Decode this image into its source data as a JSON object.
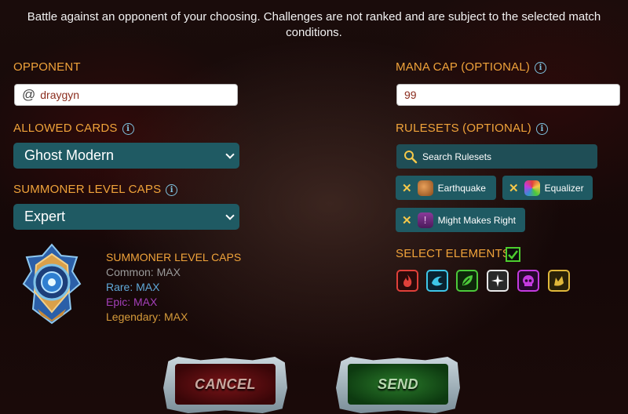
{
  "intro": "Battle against an opponent of your choosing. Challenges are not ranked and are subject to the selected match conditions.",
  "opponent": {
    "label": "OPPONENT",
    "prefix": "@",
    "value": "draygyn"
  },
  "allowed_cards": {
    "label": "ALLOWED CARDS",
    "value": "Ghost Modern"
  },
  "summoner_level_caps": {
    "label": "SUMMONER LEVEL CAPS",
    "value": "Expert",
    "panel_title": "SUMMONER LEVEL CAPS",
    "caps": [
      {
        "text": "Common: MAX",
        "color": "#9a9a9a"
      },
      {
        "text": "Rare: MAX",
        "color": "#5fa8d8"
      },
      {
        "text": "Epic: MAX",
        "color": "#a43fb8"
      },
      {
        "text": "Legendary: MAX",
        "color": "#d59a3a"
      }
    ]
  },
  "mana_cap": {
    "label": "MANA CAP (OPTIONAL)",
    "value": "99"
  },
  "rulesets": {
    "label": "RULESETS (OPTIONAL)",
    "search_placeholder": "Search Rulesets",
    "selected": [
      {
        "name": "Earthquake",
        "icon": "earthquake-icon",
        "color": "#b8602a"
      },
      {
        "name": "Equalizer",
        "icon": "equalizer-icon",
        "color": "#3a8bd6"
      },
      {
        "name": "Might Makes Right",
        "icon": "might-makes-right-icon",
        "color": "#6a2a7a"
      }
    ]
  },
  "select_elements": {
    "label": "SELECT ELEMENTS?",
    "checked": true,
    "elements": [
      {
        "name": "fire",
        "icon": "fire-icon",
        "color": "#e0403a"
      },
      {
        "name": "water",
        "icon": "water-icon",
        "color": "#3ec6e8"
      },
      {
        "name": "earth",
        "icon": "earth-icon",
        "color": "#4cc93a"
      },
      {
        "name": "life",
        "icon": "life-icon",
        "color": "#e8e8e8"
      },
      {
        "name": "death",
        "icon": "death-icon",
        "color": "#c43ae0"
      },
      {
        "name": "dragon",
        "icon": "dragon-icon",
        "color": "#e0b83a"
      }
    ]
  },
  "buttons": {
    "cancel": "CANCEL",
    "send": "SEND"
  },
  "colors": {
    "accent": "#f0a33a",
    "panel": "#1f5a63",
    "check": "#4ccd2e"
  }
}
